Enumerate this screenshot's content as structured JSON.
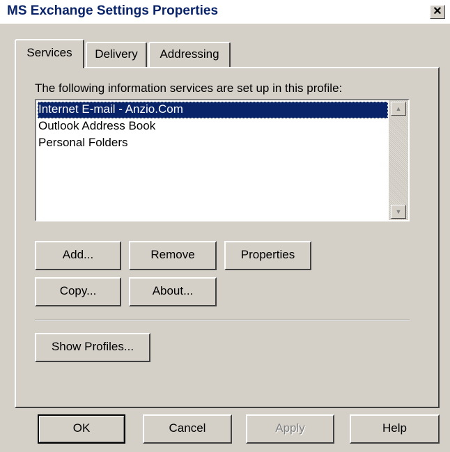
{
  "window": {
    "title": "MS Exchange Settings Properties",
    "close_glyph": "✕"
  },
  "tabs": [
    {
      "label": "Services",
      "active": true
    },
    {
      "label": "Delivery",
      "active": false
    },
    {
      "label": "Addressing",
      "active": false
    }
  ],
  "services": {
    "info_label": "The following information services are set up in this profile:",
    "items": [
      {
        "label": "Internet E-mail - Anzio.Com",
        "selected": true
      },
      {
        "label": "Outlook Address Book",
        "selected": false
      },
      {
        "label": "Personal Folders",
        "selected": false
      }
    ],
    "buttons": {
      "add": "Add...",
      "remove": "Remove",
      "properties": "Properties",
      "copy": "Copy...",
      "about": "About...",
      "show_profiles": "Show Profiles..."
    }
  },
  "footer": {
    "ok": "OK",
    "cancel": "Cancel",
    "apply": "Apply",
    "help": "Help"
  },
  "colors": {
    "face": "#d4d0c8",
    "selection": "#0a246a",
    "title_text": "#0a246a"
  }
}
